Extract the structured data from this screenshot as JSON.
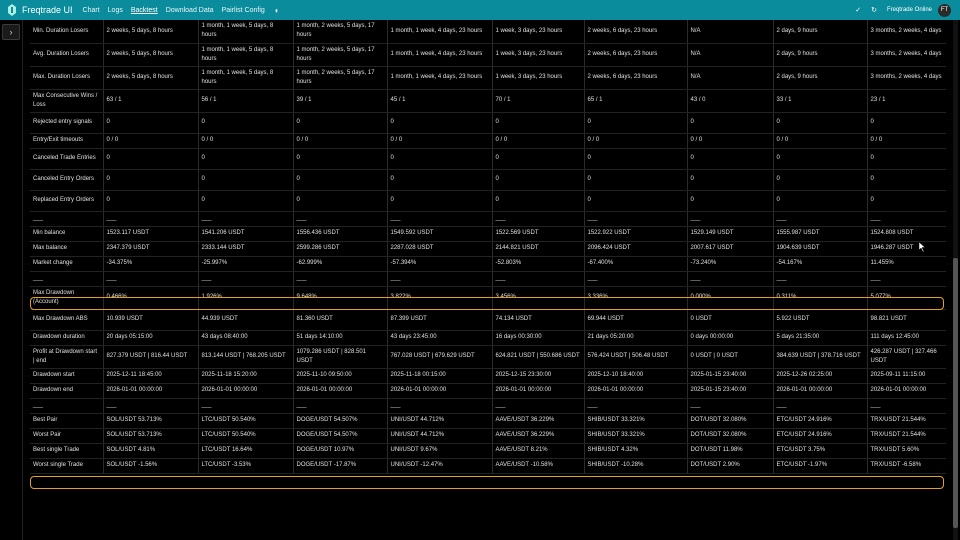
{
  "app": {
    "title": "Freqtrade UI",
    "status": "Freqtrade Online",
    "avatar": "FT"
  },
  "nav": [
    "Chart",
    "Logs",
    "Backtest",
    "Download Data",
    "Pairlist Config"
  ],
  "active_nav": 2,
  "colors": {
    "topbar": "#0a8c9c",
    "highlight": "#e2a21f"
  },
  "icons": {
    "logo": "freqtrade-logo-icon",
    "theme": "theme-toggle-icon",
    "check": "check-icon",
    "refresh": "refresh-icon",
    "sidebar": "chevron-right-icon"
  },
  "table": {
    "rows": [
      {
        "label": "Min. Duration Losers",
        "cells": [
          "2 weeks, 5 days, 8 hours",
          "1 month, 1 week, 5 days, 8 hours",
          "1 month, 2 weeks, 5 days, 17 hours",
          "1 month, 1 week, 4 days, 23 hours",
          "1 week, 3 days, 23 hours",
          "2 weeks, 6 days, 23 hours",
          "N/A",
          "2 days, 9 hours",
          "3 months, 2 weeks, 4 days"
        ]
      },
      {
        "label": "Avg. Duration Losers",
        "cells": [
          "2 weeks, 5 days, 8 hours",
          "1 month, 1 week, 5 days, 8 hours",
          "1 month, 2 weeks, 5 days, 17 hours",
          "1 month, 1 week, 4 days, 23 hours",
          "1 week, 3 days, 23 hours",
          "2 weeks, 6 days, 23 hours",
          "N/A",
          "2 days, 9 hours",
          "3 months, 2 weeks, 4 days"
        ]
      },
      {
        "label": "Max. Duration Losers",
        "cells": [
          "2 weeks, 5 days, 8 hours",
          "1 month, 1 week, 5 days, 8 hours",
          "1 month, 2 weeks, 5 days, 17 hours",
          "1 month, 1 week, 4 days, 23 hours",
          "1 week, 3 days, 23 hours",
          "2 weeks, 6 days, 23 hours",
          "N/A",
          "2 days, 9 hours",
          "3 months, 2 weeks, 4 days"
        ]
      },
      {
        "label": "Max Consecutive Wins / Loss",
        "cells": [
          "63 / 1",
          "56 / 1",
          "39 / 1",
          "45 / 1",
          "70 / 1",
          "65 / 1",
          "43 / 0",
          "33 / 1",
          "23 / 1"
        ]
      },
      {
        "label": "Rejected entry signals",
        "cells": [
          "0",
          "0",
          "0",
          "0",
          "0",
          "0",
          "0",
          "0",
          "0"
        ]
      },
      {
        "label": "Entry/Exit timeouts",
        "cells": [
          "0 / 0",
          "0 / 0",
          "0 / 0",
          "0 / 0",
          "0 / 0",
          "0 / 0",
          "0 / 0",
          "0 / 0",
          "0 / 0"
        ]
      },
      {
        "label": "Canceled Trade Entries",
        "cells": [
          "0",
          "0",
          "0",
          "0",
          "0",
          "0",
          "0",
          "0",
          "0"
        ]
      },
      {
        "label": "Canceled Entry Orders",
        "cells": [
          "0",
          "0",
          "0",
          "0",
          "0",
          "0",
          "0",
          "0",
          "0"
        ]
      },
      {
        "label": "Replaced Entry Orders",
        "cells": [
          "0",
          "0",
          "0",
          "0",
          "0",
          "0",
          "0",
          "0",
          "0"
        ]
      },
      {
        "label": "___",
        "cells": [
          "___",
          "___",
          "___",
          "___",
          "___",
          "___",
          "___",
          "___",
          "___"
        ]
      },
      {
        "label": "Min balance",
        "cells": [
          "1523.117 USDT",
          "1541.206 USDT",
          "1556.436 USDT",
          "1549.592 USDT",
          "1522.569 USDT",
          "1522.922 USDT",
          "1529.149 USDT",
          "1555.987 USDT",
          "1524.808 USDT"
        ]
      },
      {
        "label": "Max balance",
        "cells": [
          "2347.379 USDT",
          "2333.144 USDT",
          "2599.286 USDT",
          "2287.028 USDT",
          "2144.821 USDT",
          "2096.424 USDT",
          "2007.617 USDT",
          "1904.639 USDT",
          "1946.287 USDT"
        ]
      },
      {
        "label": "Market change",
        "cells": [
          "-34.375%",
          "-25.997%",
          "-62.999%",
          "-57.394%",
          "-52.803%",
          "-67.400%",
          "-73.240%",
          "-54.167%",
          "11.455%"
        ]
      },
      {
        "label": "___",
        "cells": [
          "___",
          "___",
          "___",
          "___",
          "___",
          "___",
          "___",
          "___",
          "___"
        ]
      },
      {
        "label": "Max Drawdown (Account)",
        "cells": [
          "0.466%",
          "1.926%",
          "9.648%",
          "3.822%",
          "3.456%",
          "3.336%",
          "0.000%",
          "0.311%",
          "5.077%"
        ]
      },
      {
        "label": "Max Drawdown ABS",
        "cells": [
          "10.939 USDT",
          "44.939 USDT",
          "81.360 USDT",
          "87.399 USDT",
          "74.134 USDT",
          "69.944 USDT",
          "0 USDT",
          "5.922 USDT",
          "98.821 USDT"
        ]
      },
      {
        "label": "Drawdown duration",
        "cells": [
          "20 days 05:15:00",
          "43 days 08:40:00",
          "51 days 14:10:00",
          "43 days 23:45:00",
          "16 days 00:30:00",
          "21 days 05:20:00",
          "0 days 00:00:00",
          "5 days 21:35:00",
          "111 days 12:45:00"
        ]
      },
      {
        "label": "Profit at Drawdown start | end",
        "cells": [
          "827.379 USDT | 816.44 USDT",
          "813.144 USDT | 768.205 USDT",
          "1079.286 USDT | 828.501 USDT",
          "767.028 USDT | 679.629 USDT",
          "624.821 USDT | 550.686 USDT",
          "576.424 USDT | 506.48 USDT",
          "0 USDT | 0 USDT",
          "384.639 USDT | 378.716 USDT",
          "426.287 USDT | 327.466 USDT"
        ]
      },
      {
        "label": "Drawdown start",
        "cells": [
          "2025-12-11 18:45:00",
          "2025-11-18 15:20:00",
          "2025-11-10 09:50:00",
          "2025-11-18 00:15:00",
          "2025-12-15 23:30:00",
          "2025-12-10 18:40:00",
          "2025-01-15 23:40:00",
          "2025-12-26 02:25:00",
          "2025-09-11 11:15:00"
        ]
      },
      {
        "label": "Drawdown end",
        "cells": [
          "2026-01-01 00:00:00",
          "2026-01-01 00:00:00",
          "2026-01-01 00:00:00",
          "2026-01-01 00:00:00",
          "2026-01-01 00:00:00",
          "2026-01-01 00:00:00",
          "2025-01-15 23:40:00",
          "2026-01-01 00:00:00",
          "2026-01-01 00:00:00"
        ]
      },
      {
        "label": "___",
        "cells": [
          "___",
          "___",
          "___",
          "___",
          "___",
          "___",
          "___",
          "___",
          "___"
        ]
      },
      {
        "label": "Best Pair",
        "cells": [
          "SOL/USDT 53.713%",
          "LTC/USDT 50.540%",
          "DOGE/USDT 54.507%",
          "UNI/USDT 44.712%",
          "AAVE/USDT 36.229%",
          "SHIB/USDT 33.321%",
          "DOT/USDT 32.080%",
          "ETC/USDT 24.916%",
          "TRX/USDT 21.544%"
        ]
      },
      {
        "label": "Worst Pair",
        "cells": [
          "SOL/USDT 53.713%",
          "LTC/USDT 50.540%",
          "DOGE/USDT 54.507%",
          "UNI/USDT 44.712%",
          "AAVE/USDT 36.229%",
          "SHIB/USDT 33.321%",
          "DOT/USDT 32.080%",
          "ETC/USDT 24.916%",
          "TRX/USDT 21.544%"
        ]
      },
      {
        "label": "Best single Trade",
        "cells": [
          "SOL/USDT 4.81%",
          "LTC/USDT 16.64%",
          "DOGE/USDT 10.97%",
          "UNI/USDT 9.67%",
          "AAVE/USDT 8.21%",
          "SHIB/USDT 4.32%",
          "DOT/USDT 11.98%",
          "ETC/USDT 3.75%",
          "TRX/USDT 5.60%"
        ]
      },
      {
        "label": "Worst single Trade",
        "cells": [
          "SOL/USDT -1.56%",
          "LTC/USDT -3.53%",
          "DOGE/USDT -17.87%",
          "UNI/USDT -12.47%",
          "AAVE/USDT -10.58%",
          "SHIB/USDT -10.28%",
          "DOT/USDT 2.90%",
          "ETC/USDT -1.97%",
          "TRX/USDT -6.58%"
        ]
      }
    ]
  }
}
